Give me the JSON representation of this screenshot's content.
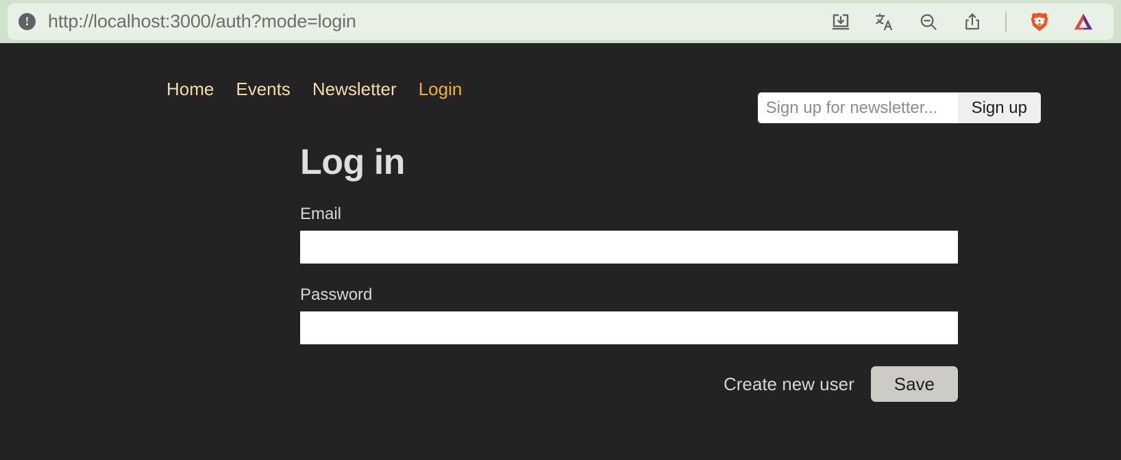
{
  "browser": {
    "url": "http://localhost:3000/auth?mode=login",
    "site_info_glyph": "!",
    "icons": [
      {
        "name": "download-icon",
        "label": "Downloads"
      },
      {
        "name": "translate-icon",
        "label": "Translate"
      },
      {
        "name": "zoom-out-icon",
        "label": "Zoom out"
      },
      {
        "name": "share-icon",
        "label": "Share"
      },
      {
        "name": "brave-lion-icon",
        "label": "Brave Shields"
      },
      {
        "name": "bat-triangle-icon",
        "label": "Brave Rewards"
      }
    ],
    "colors": {
      "chrome_background": "#cfe2cb",
      "urlbar_background": "#e9f1e7",
      "url_text": "#6b6f6a",
      "brave_orange": "#f0521f",
      "bat_purple": "#662d91",
      "bat_red": "#e8463c"
    }
  },
  "site": {
    "nav": [
      {
        "label": "Home",
        "active": false
      },
      {
        "label": "Events",
        "active": false
      },
      {
        "label": "Newsletter",
        "active": false
      },
      {
        "label": "Login",
        "active": true
      }
    ],
    "newsletter": {
      "placeholder": "Sign up for newsletter...",
      "value": "",
      "button_label": "Sign up"
    },
    "colors": {
      "page_background": "#232323",
      "nav_link": "#f6dcab",
      "nav_link_active": "#f0b429",
      "heading": "#dedede",
      "button_background": "#cccbc6"
    }
  },
  "auth": {
    "title": "Log in",
    "fields": [
      {
        "label": "Email",
        "value": "",
        "placeholder": "",
        "type": "email"
      },
      {
        "label": "Password",
        "value": "",
        "placeholder": "",
        "type": "password"
      }
    ],
    "switch_mode_label": "Create new user",
    "submit_label": "Save"
  }
}
